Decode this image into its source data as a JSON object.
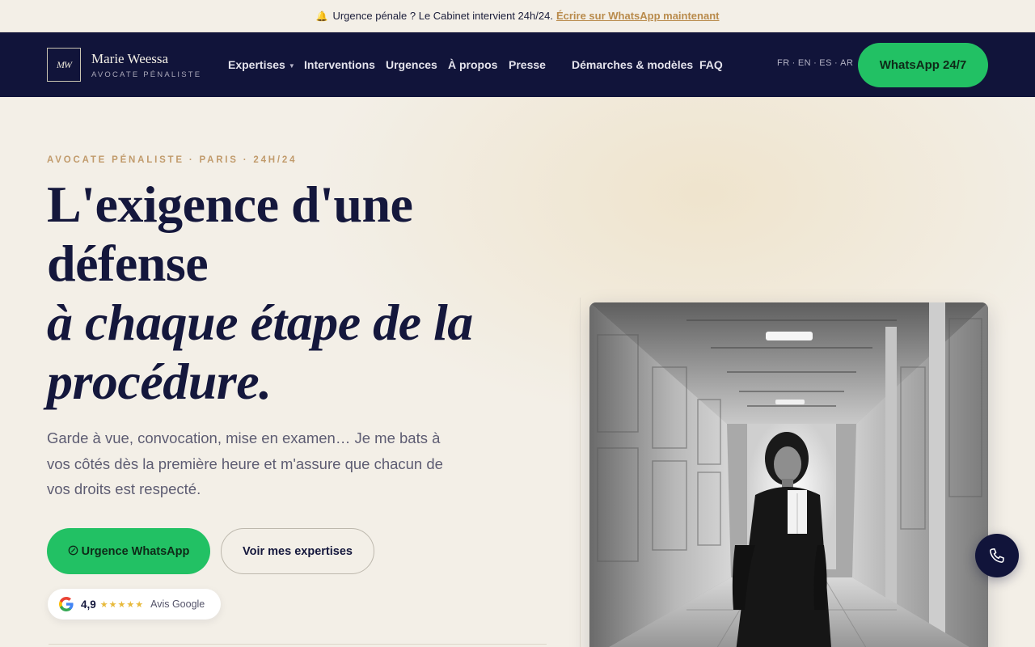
{
  "announcement": {
    "icon": "bell-icon",
    "text": "Urgence pénale ? Le Cabinet intervient 24h/24.",
    "link_label": "Écrire sur WhatsApp maintenant"
  },
  "brand": {
    "monogram": "MW",
    "name": "Marie Weessa",
    "tagline": "AVOCATE PÉNALISTE"
  },
  "nav": {
    "items": [
      {
        "label": "Expertises",
        "has_dropdown": true
      },
      {
        "label": "Interventions"
      },
      {
        "label": "Urgences"
      },
      {
        "label": "À propos"
      },
      {
        "label": "Presse"
      },
      {
        "label": "Démarches & modèles"
      },
      {
        "label": "FAQ"
      }
    ],
    "languages": [
      "FR",
      "EN",
      "ES",
      "AR"
    ],
    "cta_label": "WhatsApp 24/7"
  },
  "hero": {
    "eyebrow": "AVOCATE PÉNALISTE · PARIS · 24H/24",
    "title_line1": "L'exigence d'une",
    "title_line2": "défense",
    "title_line3": "à chaque étape de la",
    "title_line4": "procédure.",
    "lede": "Garde à vue, convocation, mise en examen… Je me bats à vos côtés dès la première heure et m'assure que chacun de vos droits est respecté.",
    "primary_cta": "Urgence WhatsApp",
    "secondary_cta": "Voir mes expertises",
    "rating": {
      "score": "4,9",
      "stars": "★★★★★",
      "label": "Avis Google"
    },
    "photo": "lawyer-in-courthouse-corridor"
  },
  "floating": {
    "call_icon": "phone-icon"
  },
  "colors": {
    "navy": "#11143a",
    "green": "#22c164",
    "gold": "#c19b6c",
    "cream": "#f3efe7"
  }
}
